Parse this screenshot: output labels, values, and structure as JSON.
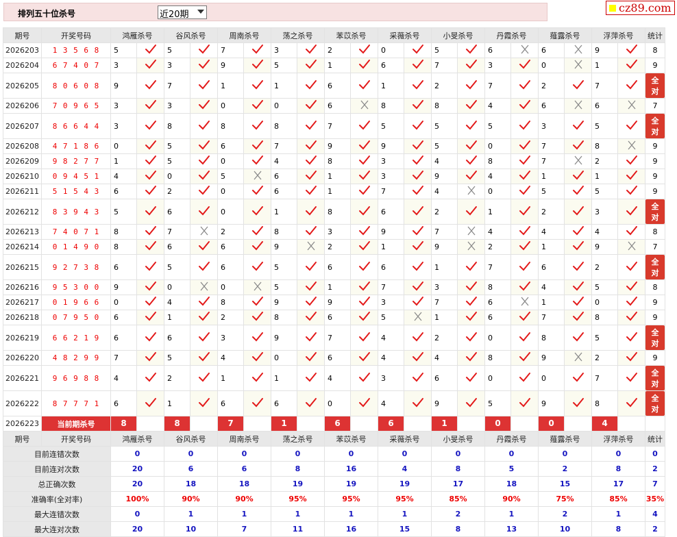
{
  "header": {
    "title": "排列五十位杀号",
    "period_select": "近20期",
    "logo": "cz89.com"
  },
  "columns": {
    "period": "期号",
    "draw": "开奖号码",
    "experts": [
      "鸿雁杀号",
      "谷风杀号",
      "周南杀号",
      "荡之杀号",
      "苯苡杀号",
      "采薇杀号",
      "小旻杀号",
      "丹霞杀号",
      "薤露杀号",
      "浮萍杀号"
    ],
    "stat": "统计"
  },
  "rows": [
    {
      "period": "2026203",
      "draw": "13568",
      "kills": [
        5,
        5,
        7,
        3,
        2,
        0,
        5,
        6,
        6,
        9
      ],
      "results": [
        1,
        1,
        1,
        1,
        1,
        1,
        1,
        0,
        0,
        1
      ],
      "stat": "8"
    },
    {
      "period": "2026204",
      "draw": "67407",
      "kills": [
        3,
        3,
        9,
        5,
        1,
        6,
        7,
        3,
        0,
        1
      ],
      "results": [
        1,
        1,
        1,
        1,
        1,
        1,
        1,
        1,
        0,
        1
      ],
      "stat": "9"
    },
    {
      "period": "2026205",
      "draw": "80608",
      "kills": [
        9,
        7,
        1,
        1,
        6,
        1,
        2,
        7,
        2,
        7
      ],
      "results": [
        1,
        1,
        1,
        1,
        1,
        1,
        1,
        1,
        1,
        1
      ],
      "stat": "全对"
    },
    {
      "period": "2026206",
      "draw": "70965",
      "kills": [
        3,
        3,
        0,
        0,
        6,
        8,
        8,
        4,
        6,
        6
      ],
      "results": [
        1,
        1,
        1,
        1,
        0,
        1,
        1,
        1,
        0,
        0
      ],
      "stat": "7"
    },
    {
      "period": "2026207",
      "draw": "86644",
      "kills": [
        3,
        8,
        8,
        8,
        7,
        5,
        5,
        5,
        3,
        5
      ],
      "results": [
        1,
        1,
        1,
        1,
        1,
        1,
        1,
        1,
        1,
        1
      ],
      "stat": "全对"
    },
    {
      "period": "2026208",
      "draw": "47186",
      "kills": [
        0,
        5,
        6,
        7,
        9,
        9,
        5,
        0,
        7,
        8
      ],
      "results": [
        1,
        1,
        1,
        1,
        1,
        1,
        1,
        1,
        1,
        0
      ],
      "stat": "9"
    },
    {
      "period": "2026209",
      "draw": "98277",
      "kills": [
        1,
        5,
        0,
        4,
        8,
        3,
        4,
        8,
        7,
        2
      ],
      "results": [
        1,
        1,
        1,
        1,
        1,
        1,
        1,
        1,
        0,
        1
      ],
      "stat": "9"
    },
    {
      "period": "2026210",
      "draw": "09451",
      "kills": [
        4,
        0,
        5,
        6,
        1,
        3,
        9,
        4,
        1,
        1
      ],
      "results": [
        1,
        1,
        0,
        1,
        1,
        1,
        1,
        1,
        1,
        1
      ],
      "stat": "9"
    },
    {
      "period": "2026211",
      "draw": "51543",
      "kills": [
        6,
        2,
        0,
        6,
        1,
        7,
        4,
        0,
        5,
        5
      ],
      "results": [
        1,
        1,
        1,
        1,
        1,
        1,
        0,
        1,
        1,
        1
      ],
      "stat": "9"
    },
    {
      "period": "2026212",
      "draw": "83943",
      "kills": [
        5,
        6,
        0,
        1,
        8,
        6,
        2,
        1,
        2,
        3
      ],
      "results": [
        1,
        1,
        1,
        1,
        1,
        1,
        1,
        1,
        1,
        1
      ],
      "stat": "全对"
    },
    {
      "period": "2026213",
      "draw": "74071",
      "kills": [
        8,
        7,
        2,
        8,
        3,
        9,
        7,
        4,
        4,
        4
      ],
      "results": [
        1,
        0,
        1,
        1,
        1,
        1,
        0,
        1,
        1,
        1
      ],
      "stat": "8"
    },
    {
      "period": "2026214",
      "draw": "01490",
      "kills": [
        8,
        6,
        6,
        9,
        2,
        1,
        9,
        2,
        1,
        9
      ],
      "results": [
        1,
        1,
        1,
        0,
        1,
        1,
        0,
        1,
        1,
        0
      ],
      "stat": "7"
    },
    {
      "period": "2026215",
      "draw": "92738",
      "kills": [
        6,
        5,
        6,
        5,
        6,
        6,
        1,
        7,
        6,
        2
      ],
      "results": [
        1,
        1,
        1,
        1,
        1,
        1,
        1,
        1,
        1,
        1
      ],
      "stat": "全对"
    },
    {
      "period": "2026216",
      "draw": "95300",
      "kills": [
        9,
        0,
        0,
        5,
        1,
        7,
        3,
        8,
        4,
        5
      ],
      "results": [
        1,
        0,
        0,
        1,
        1,
        1,
        1,
        1,
        1,
        1
      ],
      "stat": "8"
    },
    {
      "period": "2026217",
      "draw": "01966",
      "kills": [
        0,
        4,
        8,
        9,
        9,
        3,
        7,
        6,
        1,
        0
      ],
      "results": [
        1,
        1,
        1,
        1,
        1,
        1,
        1,
        0,
        1,
        1
      ],
      "stat": "9"
    },
    {
      "period": "2026218",
      "draw": "07950",
      "kills": [
        6,
        1,
        2,
        8,
        6,
        5,
        1,
        6,
        7,
        8
      ],
      "results": [
        1,
        1,
        1,
        1,
        1,
        0,
        1,
        1,
        1,
        1
      ],
      "stat": "9"
    },
    {
      "period": "2026219",
      "draw": "66219",
      "kills": [
        6,
        6,
        3,
        9,
        7,
        4,
        2,
        0,
        8,
        5
      ],
      "results": [
        1,
        1,
        1,
        1,
        1,
        1,
        1,
        1,
        1,
        1
      ],
      "stat": "全对"
    },
    {
      "period": "2026220",
      "draw": "48299",
      "kills": [
        7,
        5,
        4,
        0,
        6,
        4,
        4,
        8,
        9,
        2
      ],
      "results": [
        1,
        1,
        1,
        1,
        1,
        1,
        1,
        1,
        0,
        1
      ],
      "stat": "9"
    },
    {
      "period": "2026221",
      "draw": "96988",
      "kills": [
        4,
        2,
        1,
        1,
        4,
        3,
        6,
        0,
        0,
        7
      ],
      "results": [
        1,
        1,
        1,
        1,
        1,
        1,
        1,
        1,
        1,
        1
      ],
      "stat": "全对"
    },
    {
      "period": "2026222",
      "draw": "87771",
      "kills": [
        6,
        1,
        6,
        6,
        0,
        4,
        9,
        5,
        9,
        8
      ],
      "results": [
        1,
        1,
        1,
        1,
        1,
        1,
        1,
        1,
        1,
        1
      ],
      "stat": "全对"
    }
  ],
  "current": {
    "period": "2026223",
    "label": "当前期杀号",
    "kills": [
      8,
      8,
      7,
      1,
      6,
      6,
      1,
      0,
      0,
      4
    ]
  },
  "stats": [
    {
      "label": "目前连错次数",
      "values": [
        "0",
        "0",
        "0",
        "0",
        "0",
        "0",
        "0",
        "0",
        "0",
        "0",
        "0"
      ]
    },
    {
      "label": "目前连对次数",
      "values": [
        "20",
        "6",
        "6",
        "8",
        "16",
        "4",
        "8",
        "5",
        "2",
        "8",
        "2"
      ]
    },
    {
      "label": "总正确次数",
      "values": [
        "20",
        "18",
        "18",
        "19",
        "19",
        "19",
        "17",
        "18",
        "15",
        "17",
        "7"
      ]
    },
    {
      "label": "准确率(全对率)",
      "values": [
        "100%",
        "90%",
        "90%",
        "95%",
        "95%",
        "95%",
        "85%",
        "90%",
        "75%",
        "85%",
        "35%"
      ],
      "pct": true
    },
    {
      "label": "最大连错次数",
      "values": [
        "0",
        "1",
        "1",
        "1",
        "1",
        "1",
        "2",
        "1",
        "2",
        "1",
        "4"
      ]
    },
    {
      "label": "最大连对次数",
      "values": [
        "20",
        "10",
        "7",
        "11",
        "16",
        "15",
        "8",
        "13",
        "10",
        "8",
        "2"
      ]
    }
  ],
  "colors": {
    "tick": "#e31a1a",
    "cross": "#8a8a8a",
    "accent": "#d33",
    "stat_blue": "#1515c0"
  },
  "icons": {
    "correct": "check-icon",
    "wrong": "cross-icon"
  }
}
